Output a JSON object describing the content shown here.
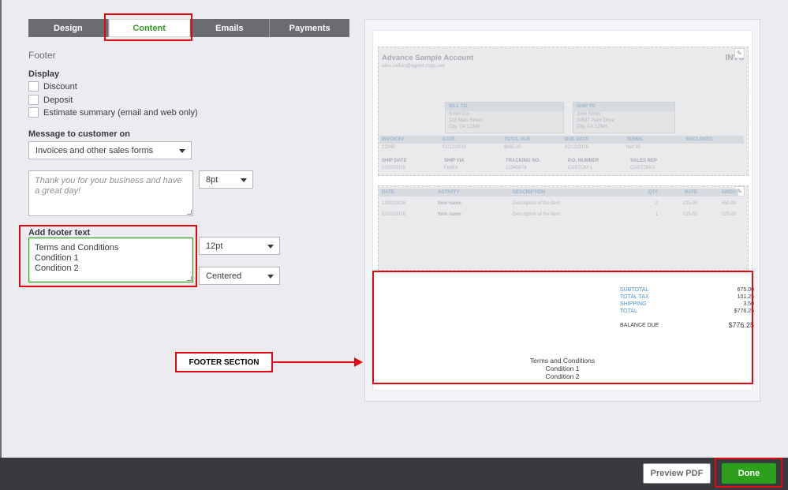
{
  "tabs": [
    {
      "label": "Design",
      "active": false
    },
    {
      "label": "Content",
      "active": true
    },
    {
      "label": "Emails",
      "active": false
    },
    {
      "label": "Payments",
      "active": false
    }
  ],
  "section_title": "Footer",
  "display": {
    "label": "Display",
    "options": [
      "Discount",
      "Deposit",
      "Estimate summary (email and web only)"
    ]
  },
  "message": {
    "label": "Message to customer on",
    "selected": "Invoices and other sales forms",
    "placeholder": "Thank you for your business and have a great day!",
    "font_size": "8pt"
  },
  "footer": {
    "label": "Add footer text",
    "lines": [
      "Terms and Conditions",
      "Condition 1",
      "Condition 2"
    ],
    "font_size": "12pt",
    "alignment": "Centered"
  },
  "invoice_preview": {
    "company": "Advance Sample Account",
    "email": "alex.vallon@agent.cvgs.net",
    "doc_title": "INVO",
    "bill_to": {
      "header": "BILL TO",
      "lines": [
        "Smith Co.",
        "123 Main Street",
        "City, CA 12345"
      ]
    },
    "ship_to": {
      "header": "SHIP TO",
      "lines": [
        "John Smith",
        "20637 Palm Drive",
        "City, CA 12345"
      ]
    },
    "summary_headers": [
      "INVOICE#",
      "DATE",
      "TOTAL DUE",
      "DUE DATE",
      "TERMS",
      "ENCLOSED"
    ],
    "summary_values": [
      "12345",
      "01/12/2016",
      "$665.00",
      "02/12/2016",
      "Net 30",
      ""
    ],
    "ship_headers": [
      "SHIP DATE",
      "SHIP VIA",
      "TRACKING NO.",
      "P.O. NUMBER",
      "SALES REP"
    ],
    "ship_values": [
      "01/03/2015",
      "FedEx",
      "12345678",
      "CUSTOM-1",
      "CUSTOM-2"
    ],
    "item_headers": [
      "DATE",
      "ACTIVITY",
      "DESCRIPTION",
      "QTY",
      "RATE",
      "AMOU"
    ],
    "items": [
      [
        "12/01/2016",
        "Item name",
        "Description of the item",
        "2",
        "225.00",
        "450.00"
      ],
      [
        "01/12/2016",
        "Item name",
        "Description of the item",
        "1",
        "225.00",
        "225.00"
      ]
    ],
    "totals": [
      {
        "label": "SUBTOTAL",
        "value": "675.00"
      },
      {
        "label": "TOTAL TAX",
        "value": "101.25"
      },
      {
        "label": "SHIPPING",
        "value": "3.50"
      },
      {
        "label": "TOTAL",
        "value": "$776.25"
      }
    ],
    "balance_due_label": "BALANCE DUE",
    "balance_due_value": "$776.25",
    "footer_lines": [
      "Terms and Conditions",
      "Condition 1",
      "Condition 2"
    ]
  },
  "callout": "FOOTER SECTION",
  "buttons": {
    "preview": "Preview PDF",
    "done": "Done"
  },
  "colors": {
    "accent": "#2ca01c",
    "highlight": "#e30613",
    "tab_bg": "#6b6c72",
    "bar": "#393a3d"
  }
}
